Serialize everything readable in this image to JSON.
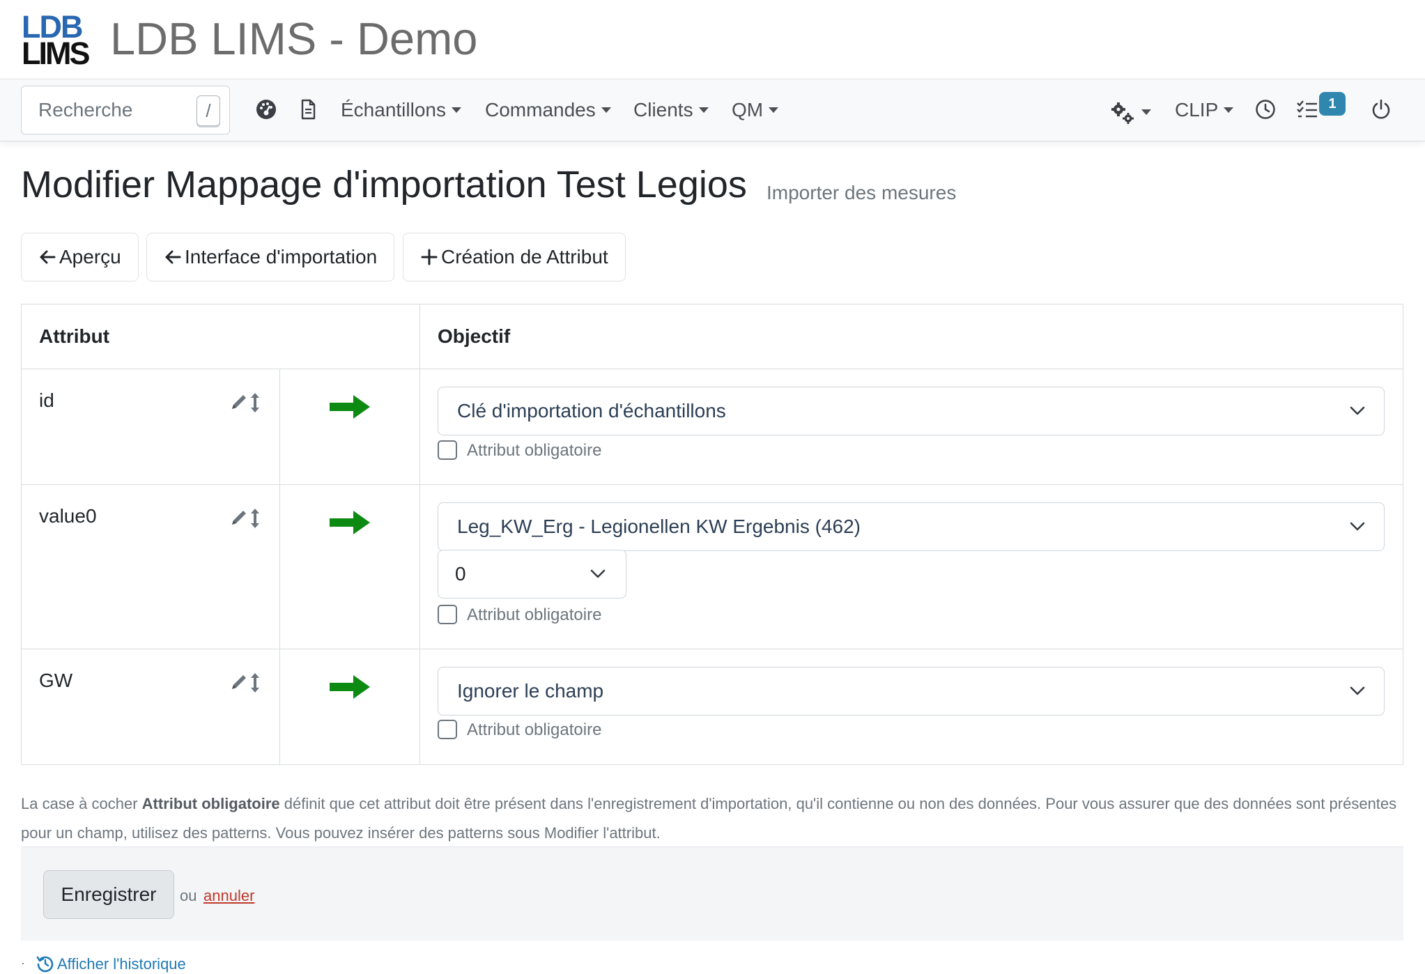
{
  "app": {
    "logo_line1": "LDB",
    "logo_line2": "LIMS",
    "title": "LDB LIMS - Demo",
    "brand_color": "#2a67b1"
  },
  "navbar": {
    "search_placeholder": "Recherche",
    "search_shortcut": "/",
    "icons": [
      "dashboard-icon",
      "document-icon"
    ],
    "menus": [
      "Échantillons",
      "Commandes",
      "Clients",
      "QM"
    ],
    "right": {
      "settings_icon": "gears-icon",
      "user_label": "CLIP",
      "clock_icon": "clock-icon",
      "tasks_icon": "tasks-icon",
      "tasks_badge": "1",
      "power_icon": "power-icon",
      "badge_color": "#2f86ae"
    }
  },
  "page": {
    "title": "Modifier Mappage d'importation Test Legios",
    "subtitle": "Importer des mesures"
  },
  "actions": {
    "overview": "Aperçu",
    "import_interface": "Interface d'importation",
    "create_attribute": "Création de Attribut"
  },
  "table": {
    "headers": {
      "attribute": "Attribut",
      "target": "Objectif"
    },
    "rows": [
      {
        "name": "id",
        "target": "Clé d'importation d'échantillons",
        "mandatory_label": "Attribut obligatoire",
        "mandatory": false
      },
      {
        "name": "value0",
        "target": "Leg_KW_Erg - Legionellen KW Ergebnis (462)",
        "sub_select": "0",
        "mandatory_label": "Attribut obligatoire",
        "mandatory": false
      },
      {
        "name": "GW",
        "target": "Ignorer le champ",
        "mandatory_label": "Attribut obligatoire",
        "mandatory": false
      }
    ],
    "arrow_color": "#0d8a12"
  },
  "help": {
    "part1": "La case à cocher ",
    "bold": "Attribut obligatoire",
    "part2": " définit que cet attribut doit être présent dans l'enregistrement d'importation, qu'il contienne ou non des données. Pour vous assurer que des données sont présentes pour un champ, utilisez des patterns. Vous pouvez insérer des patterns sous Modifier l'attribut."
  },
  "form": {
    "save": "Enregistrer",
    "or": "ou",
    "cancel": "annuler"
  },
  "footer": {
    "dot": "·",
    "history": "Afficher l'historique"
  }
}
